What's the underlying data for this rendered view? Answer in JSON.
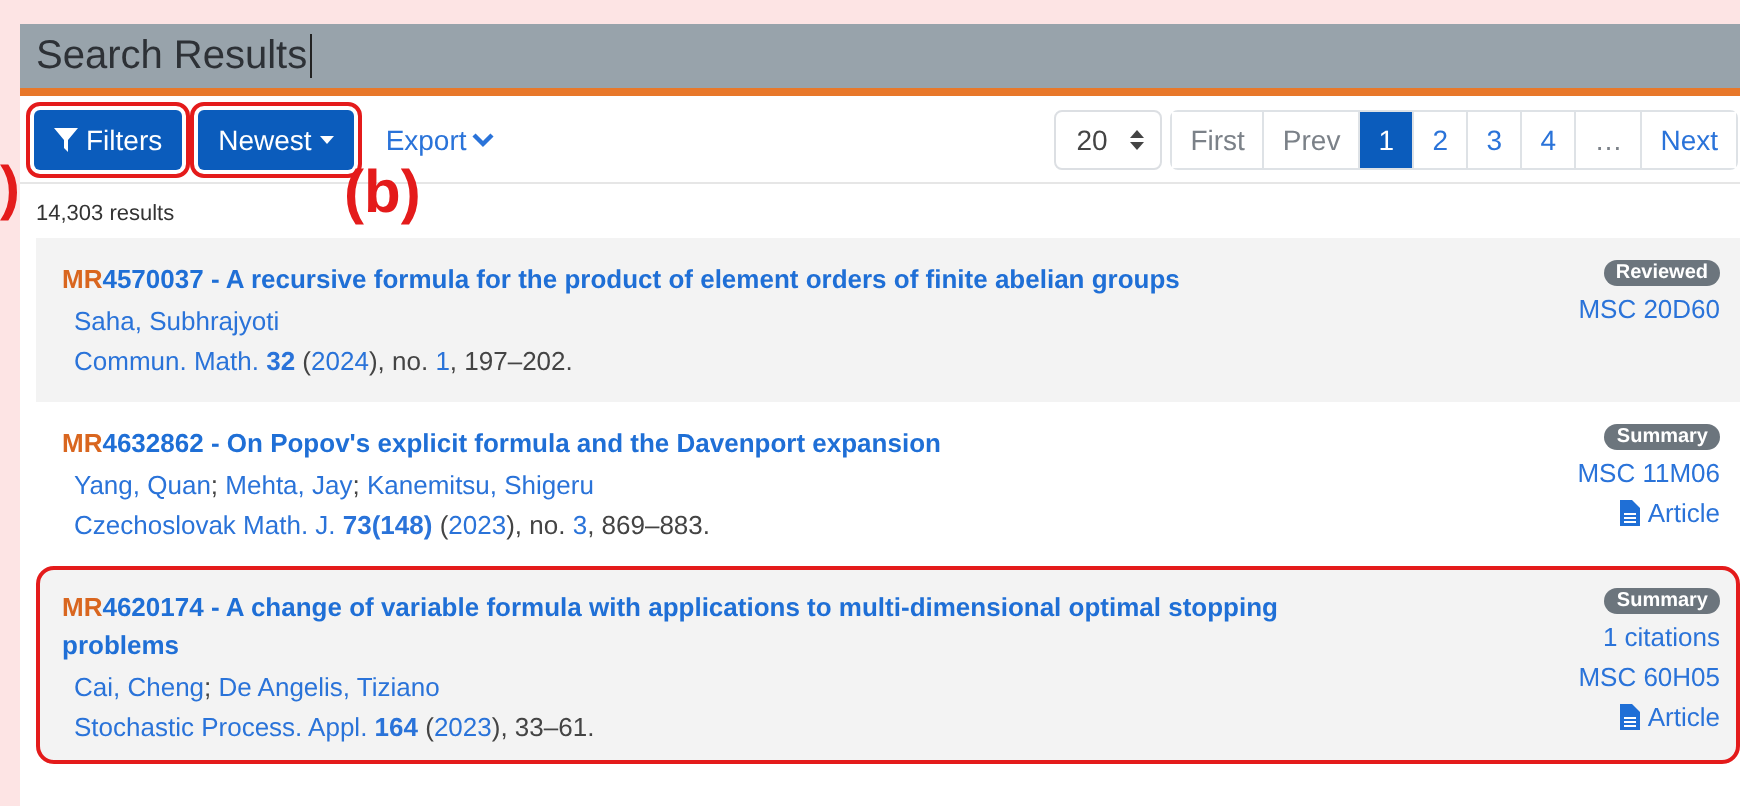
{
  "header": {
    "title": "Search Results"
  },
  "toolbar": {
    "filters": {
      "label": "Filters",
      "highlighted": true
    },
    "sort": {
      "label": "Newest",
      "highlighted": true
    },
    "export": {
      "label": "Export"
    },
    "page_size": {
      "value": "20"
    },
    "pagination": [
      {
        "label": "First",
        "selected": false,
        "disabled": true
      },
      {
        "label": "Prev",
        "selected": false,
        "disabled": true
      },
      {
        "label": "1",
        "selected": true,
        "disabled": false
      },
      {
        "label": "2",
        "selected": false,
        "disabled": false
      },
      {
        "label": "3",
        "selected": false,
        "disabled": false
      },
      {
        "label": "4",
        "selected": false,
        "disabled": false
      },
      {
        "label": "…",
        "selected": false,
        "disabled": true
      },
      {
        "label": "Next",
        "selected": false,
        "disabled": false
      }
    ]
  },
  "annotations": [
    {
      "text": ")",
      "kind": "left"
    },
    {
      "text": "(b)",
      "kind": "under-sort"
    }
  ],
  "result_count": "14,303 results",
  "results": [
    {
      "prefix": "MR",
      "number": "4570037",
      "title": "- A recursive formula for the product of element orders of finite abelian groups",
      "authors": [
        {
          "name": "Saha, Subhrajyoti"
        }
      ],
      "citation": [
        {
          "text": "Commun. Math. ",
          "kind": "link"
        },
        {
          "text": "32",
          "kind": "bold"
        },
        {
          "text": " (",
          "kind": "plain"
        },
        {
          "text": "2024",
          "kind": "link"
        },
        {
          "text": "), no. ",
          "kind": "plain"
        },
        {
          "text": "1",
          "kind": "link"
        },
        {
          "text": ", 197–202.",
          "kind": "plain"
        }
      ],
      "badge": "Reviewed",
      "msc": "MSC 20D60",
      "shaded": true,
      "highlighted": false
    },
    {
      "prefix": "MR",
      "number": "4632862",
      "title": "- On Popov's explicit formula and the Davenport expansion",
      "authors": [
        {
          "name": "Yang, Quan",
          "separator": ";"
        },
        {
          "name": "Mehta, Jay",
          "separator": ";"
        },
        {
          "name": "Kanemitsu, Shigeru"
        }
      ],
      "citation": [
        {
          "text": "Czechoslovak Math. J. ",
          "kind": "link"
        },
        {
          "text": "73(148)",
          "kind": "bold"
        },
        {
          "text": " (",
          "kind": "plain"
        },
        {
          "text": "2023",
          "kind": "link"
        },
        {
          "text": "), no. ",
          "kind": "plain"
        },
        {
          "text": "3",
          "kind": "link"
        },
        {
          "text": ", 869–883.",
          "kind": "plain"
        }
      ],
      "badge": "Summary",
      "msc": "MSC 11M06",
      "article": "Article",
      "shaded": false,
      "highlighted": false
    },
    {
      "prefix": "MR",
      "number": "4620174",
      "title": "- A change of variable formula with applications to multi-dimensional optimal stopping problems",
      "authors": [
        {
          "name": "Cai, Cheng",
          "separator": ";"
        },
        {
          "name": "De Angelis, Tiziano"
        }
      ],
      "citation": [
        {
          "text": "Stochastic Process. Appl. ",
          "kind": "link"
        },
        {
          "text": "164",
          "kind": "bold"
        },
        {
          "text": " (",
          "kind": "plain"
        },
        {
          "text": "2023",
          "kind": "link"
        },
        {
          "text": "), 33–61.",
          "kind": "plain"
        }
      ],
      "badge": "Summary",
      "citations": "1 citations",
      "msc": "MSC 60H05",
      "article": "Article",
      "shaded": true,
      "highlighted": true
    }
  ]
}
